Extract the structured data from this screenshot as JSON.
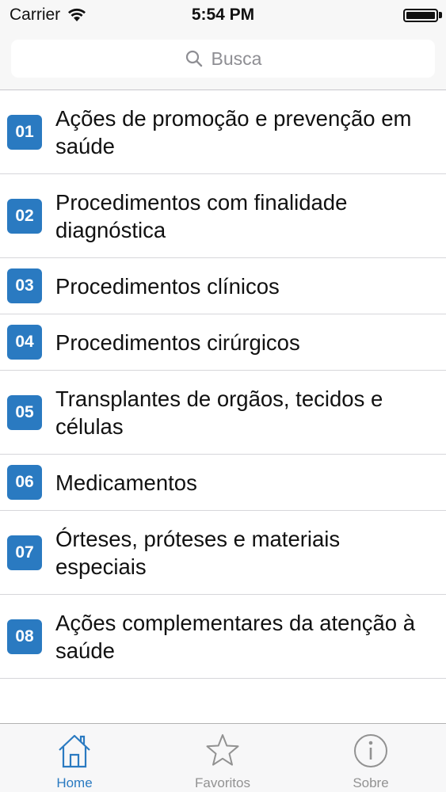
{
  "status_bar": {
    "carrier": "Carrier",
    "time": "5:54 PM"
  },
  "search": {
    "placeholder": "Busca"
  },
  "list": {
    "items": [
      {
        "badge": "01",
        "label": "Ações de promoção e prevenção em saúde"
      },
      {
        "badge": "02",
        "label": "Procedimentos com finalidade diagnóstica"
      },
      {
        "badge": "03",
        "label": "Procedimentos clínicos"
      },
      {
        "badge": "04",
        "label": "Procedimentos cirúrgicos"
      },
      {
        "badge": "05",
        "label": "Transplantes de orgãos, tecidos e células"
      },
      {
        "badge": "06",
        "label": "Medicamentos"
      },
      {
        "badge": "07",
        "label": "Órteses, próteses e materiais especiais"
      },
      {
        "badge": "08",
        "label": "Ações complementares da atenção à saúde"
      }
    ]
  },
  "tab_bar": {
    "tabs": [
      {
        "label": "Home",
        "icon": "home-icon",
        "active": true
      },
      {
        "label": "Favoritos",
        "icon": "star-icon",
        "active": false
      },
      {
        "label": "Sobre",
        "icon": "info-icon",
        "active": false
      }
    ]
  },
  "colors": {
    "accent": "#2a7ac1",
    "inactive": "#929292"
  }
}
